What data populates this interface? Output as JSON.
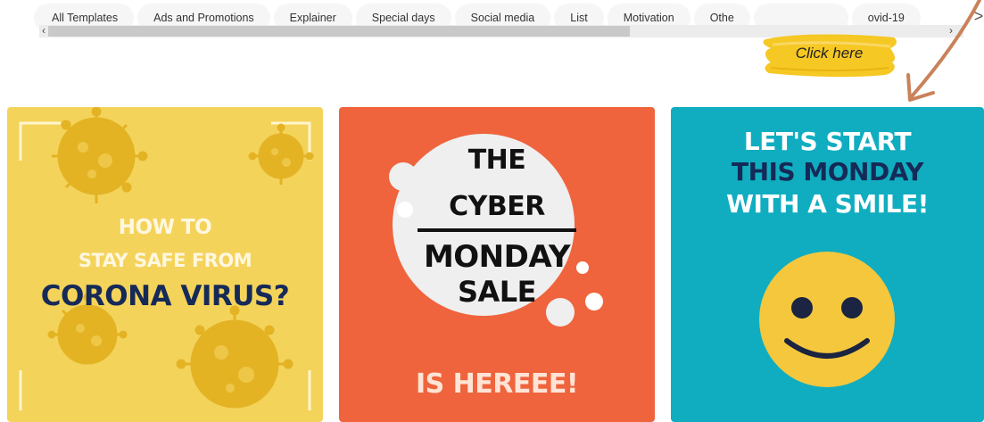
{
  "tabs": [
    "All Templates",
    "Ads and Promotions",
    "Explainer",
    "Special days",
    "Social media",
    "List",
    "Motivation",
    "Othe",
    "",
    "ovid-19"
  ],
  "scroll": {
    "left": "‹",
    "right": "›",
    "next": ">"
  },
  "callout": {
    "label": "Click here",
    "color": "#f5c518"
  },
  "cards": [
    {
      "bg": "#f4d35b",
      "line1": "HOW TO",
      "line2": "STAY SAFE FROM",
      "line3": "CORONA VIRUS?"
    },
    {
      "bg": "#ef643d",
      "line1": "THE",
      "line2": "CYBER",
      "line3": "MONDAY",
      "line4": "SALE",
      "line5": "IS HEREEE!"
    },
    {
      "bg": "#10adc0",
      "line1": "LET'S START",
      "line2": "THIS MONDAY",
      "line3": "WITH A SMILE!"
    }
  ],
  "colors": {
    "accent_arrow": "#c9825a",
    "navy": "#152a57",
    "virus": "#e3b324"
  }
}
